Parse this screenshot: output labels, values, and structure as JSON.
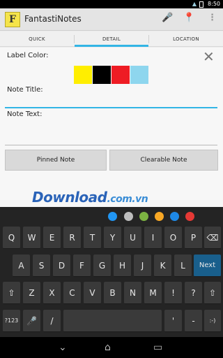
{
  "status": {
    "time": "8:50"
  },
  "app": {
    "title": "FantastiNotes",
    "icon_letter": "F"
  },
  "tabs": [
    {
      "label": "QUICK"
    },
    {
      "label": "DETAIL"
    },
    {
      "label": "LOCATION"
    }
  ],
  "active_tab": "DETAIL",
  "form": {
    "label_color": "Label Color:",
    "note_title": "Note Title:",
    "note_text": "Note Text:",
    "colors": [
      "#ffee00",
      "#000000",
      "#ee1c24",
      "#8ed6ee"
    ]
  },
  "buttons": {
    "pinned": "Pinned Note",
    "clearable": "Clearable Note"
  },
  "watermark": {
    "main": "Download",
    "domain": ".com.vn"
  },
  "keyboard": {
    "color_dots": [
      "#2196f3",
      "#bdbdbd",
      "#7cb342",
      "#f9a825",
      "#1e88e5",
      "#e53935"
    ],
    "row1": [
      "Q",
      "W",
      "E",
      "R",
      "T",
      "Y",
      "U",
      "I",
      "O",
      "P"
    ],
    "row2": [
      "A",
      "S",
      "D",
      "F",
      "G",
      "H",
      "J",
      "K",
      "L"
    ],
    "row3": [
      "Z",
      "X",
      "C",
      "V",
      "B",
      "N",
      "M",
      "!",
      "?"
    ],
    "next": "Next",
    "num": "?123",
    "slash": "/",
    "apostrophe": "'",
    "dash": "-",
    "smile": ":-)"
  }
}
